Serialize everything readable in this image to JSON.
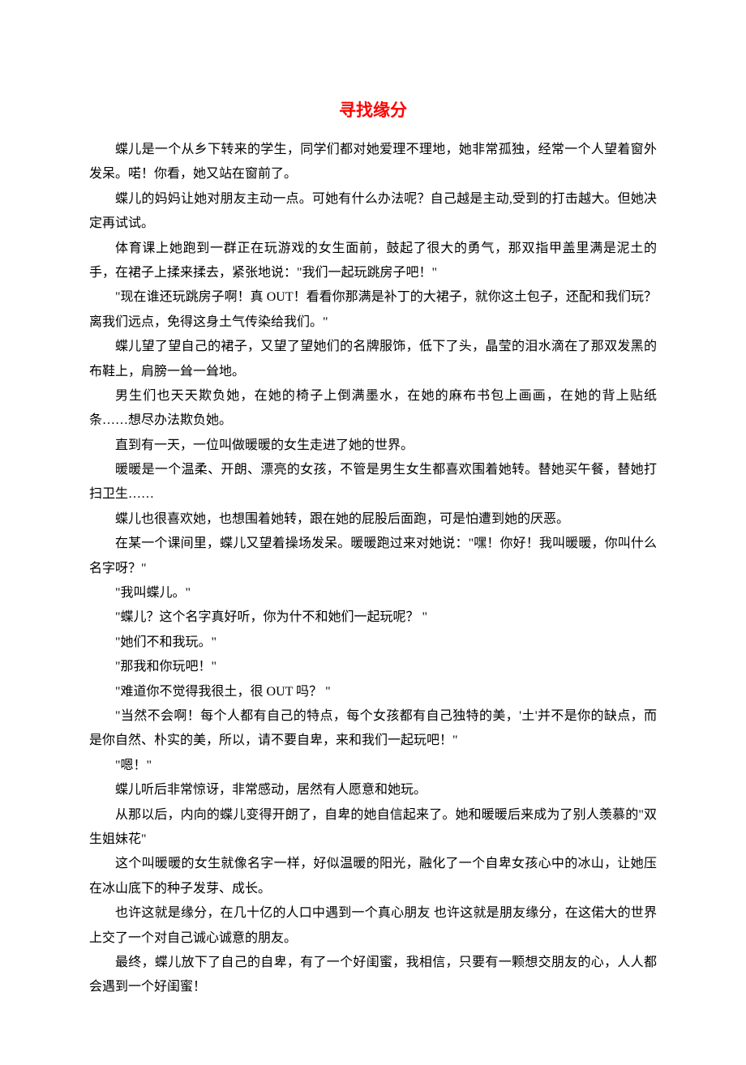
{
  "title": "寻找缘分",
  "paragraphs": [
    "蝶儿是一个从乡下转来的学生，同学们都对她爱理不理地，她非常孤独，经常一个人望着窗外发呆。喏！你看，她又站在窗前了。",
    "蝶儿的妈妈让她对朋友主动一点。可她有什么办法呢？自己越是主动,受到的打击越大。但她决定再试试。",
    "体育课上她跑到一群正在玩游戏的女生面前，鼓起了很大的勇气，那双指甲盖里满是泥土的手，在裙子上揉来揉去，紧张地说：\"我们一起玩跳房子吧！\"",
    "\"现在谁还玩跳房子啊！真 OUT！看看你那满是补丁的大裙子，就你这土包子，还配和我们玩？离我们远点，免得这身土气传染给我们。\"",
    "蝶儿望了望自己的裙子，又望了望她们的名牌服饰，低下了头，晶莹的泪水滴在了那双发黑的布鞋上，肩膀一耸一耸地。",
    "男生们也天天欺负她，在她的椅子上倒满墨水，在她的麻布书包上画画，在她的背上贴纸条……想尽办法欺负她。",
    "直到有一天，一位叫做暖暖的女生走进了她的世界。",
    "暖暖是一个温柔、开朗、漂亮的女孩，不管是男生女生都喜欢围着她转。替她买午餐，替她打扫卫生……",
    "蝶儿也很喜欢她，也想围着她转，跟在她的屁股后面跑，可是怕遭到她的厌恶。",
    "在某一个课间里，蝶儿又望着操场发呆。暖暖跑过来对她说：\"嘿！你好！我叫暖暖，你叫什么名字呀？\"",
    "\"我叫蝶儿。\"",
    "\"蝶儿？这个名字真好听，你为什不和她们一起玩呢？ \"",
    "\"她们不和我玩。\"",
    "\"那我和你玩吧！\"",
    "\"难道你不觉得我很土，很 OUT 吗？ \"",
    "\"当然不会啊！每个人都有自己的特点，每个女孩都有自己独特的美，'土'并不是你的缺点，而是你自然、朴实的美，所以，请不要自卑，来和我们一起玩吧！\"",
    "\"嗯！\"",
    "蝶儿听后非常惊讶，非常感动，居然有人愿意和她玩。",
    "从那以后，内向的蝶儿变得开朗了，自卑的她自信起来了。她和暖暖后来成为了别人羡慕的\"双生姐妹花\"",
    "这个叫暖暖的女生就像名字一样，好似温暖的阳光，融化了一个自卑女孩心中的冰山，让她压在冰山底下的种子发芽、成长。",
    "也许这就是缘分，在几十亿的人口中遇到一个真心朋友 也许这就是朋友缘分，在这偌大的世界上交了一个对自己诚心诚意的朋友。",
    "最终，蝶儿放下了自己的自卑，有了一个好闺蜜，我相信，只要有一颗想交朋友的心，人人都会遇到一个好闺蜜！"
  ]
}
